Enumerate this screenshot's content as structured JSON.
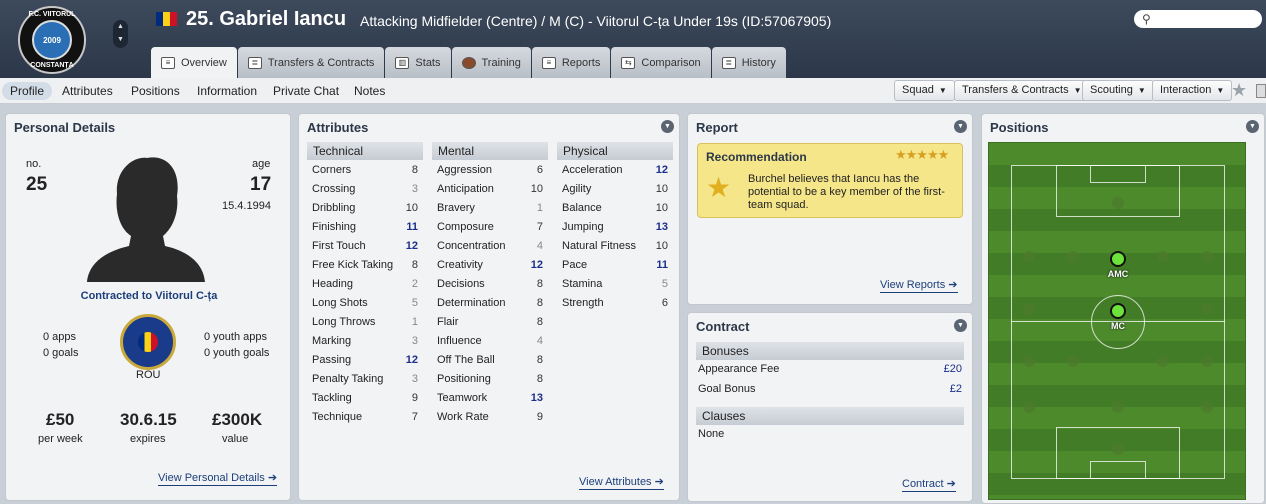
{
  "header": {
    "crest_top": "F.C. VIITORUL",
    "crest_mid": "2009",
    "crest_bottom": "CONSTANȚA",
    "player_name": "25. Gabriel Iancu",
    "player_subtitle": "Attacking Midfielder (Centre) / M (C) - Viitorul C-ța Under 19s (ID:57067905)",
    "flag_colors": [
      "#002b7f",
      "#fcd116",
      "#ce1126"
    ],
    "search_icon": "magnifier-icon"
  },
  "tabs": [
    {
      "label": "Overview",
      "icon": "overview-icon"
    },
    {
      "label": "Transfers & Contracts",
      "icon": "document-icon"
    },
    {
      "label": "Stats",
      "icon": "bar-chart-icon"
    },
    {
      "label": "Training",
      "icon": "ball-icon"
    },
    {
      "label": "Reports",
      "icon": "report-icon"
    },
    {
      "label": "Comparison",
      "icon": "compare-icon"
    },
    {
      "label": "History",
      "icon": "history-icon"
    }
  ],
  "subtabs": [
    "Profile",
    "Attributes",
    "Positions",
    "Information",
    "Private Chat",
    "Notes"
  ],
  "actions": [
    "Squad",
    "Transfers & Contracts",
    "Scouting",
    "Interaction"
  ],
  "personal": {
    "title": "Personal Details",
    "no_label": "no.",
    "no": "25",
    "age_label": "age",
    "age": "17",
    "dob": "15.4.1994",
    "contract_text": "Contracted to Viitorul C-ța",
    "apps": "0 apps",
    "goals": "0 goals",
    "youth_apps": "0 youth apps",
    "youth_goals": "0 youth goals",
    "nation": "ROU",
    "wage": "£50",
    "wage_label": "per week",
    "expires": "30.6.15",
    "expires_label": "expires",
    "value": "£300K",
    "value_label": "value",
    "link": "View Personal Details"
  },
  "attributes": {
    "title": "Attributes",
    "link": "View Attributes",
    "technical": {
      "header": "Technical",
      "rows": [
        [
          "Corners",
          "8"
        ],
        [
          "Crossing",
          "3"
        ],
        [
          "Dribbling",
          "10"
        ],
        [
          "Finishing",
          "11"
        ],
        [
          "First Touch",
          "12"
        ],
        [
          "Free Kick Taking",
          "8"
        ],
        [
          "Heading",
          "2"
        ],
        [
          "Long Shots",
          "5"
        ],
        [
          "Long Throws",
          "1"
        ],
        [
          "Marking",
          "3"
        ],
        [
          "Passing",
          "12"
        ],
        [
          "Penalty Taking",
          "3"
        ],
        [
          "Tackling",
          "9"
        ],
        [
          "Technique",
          "7"
        ]
      ]
    },
    "mental": {
      "header": "Mental",
      "rows": [
        [
          "Aggression",
          "6"
        ],
        [
          "Anticipation",
          "10"
        ],
        [
          "Bravery",
          "1"
        ],
        [
          "Composure",
          "7"
        ],
        [
          "Concentration",
          "4"
        ],
        [
          "Creativity",
          "12"
        ],
        [
          "Decisions",
          "8"
        ],
        [
          "Determination",
          "8"
        ],
        [
          "Flair",
          "8"
        ],
        [
          "Influence",
          "4"
        ],
        [
          "Off The Ball",
          "8"
        ],
        [
          "Positioning",
          "8"
        ],
        [
          "Teamwork",
          "13"
        ],
        [
          "Work Rate",
          "9"
        ]
      ]
    },
    "physical": {
      "header": "Physical",
      "rows": [
        [
          "Acceleration",
          "12"
        ],
        [
          "Agility",
          "10"
        ],
        [
          "Balance",
          "10"
        ],
        [
          "Jumping",
          "13"
        ],
        [
          "Natural Fitness",
          "10"
        ],
        [
          "Pace",
          "11"
        ],
        [
          "Stamina",
          "5"
        ],
        [
          "Strength",
          "6"
        ]
      ]
    }
  },
  "report": {
    "title": "Report",
    "rec_title": "Recommendation",
    "stars": "★★★★★",
    "text": "Burchel believes that Iancu has the potential to be a key member of the first-team squad.",
    "link": "View Reports"
  },
  "contract": {
    "title": "Contract",
    "bonuses": "Bonuses",
    "rows": [
      [
        "Appearance Fee",
        "£20"
      ],
      [
        "Goal Bonus",
        "£2"
      ]
    ],
    "clauses": "Clauses",
    "clause_value": "None",
    "link": "Contract"
  },
  "positions": {
    "title": "Positions",
    "players": [
      "AMC",
      "MC"
    ]
  }
}
